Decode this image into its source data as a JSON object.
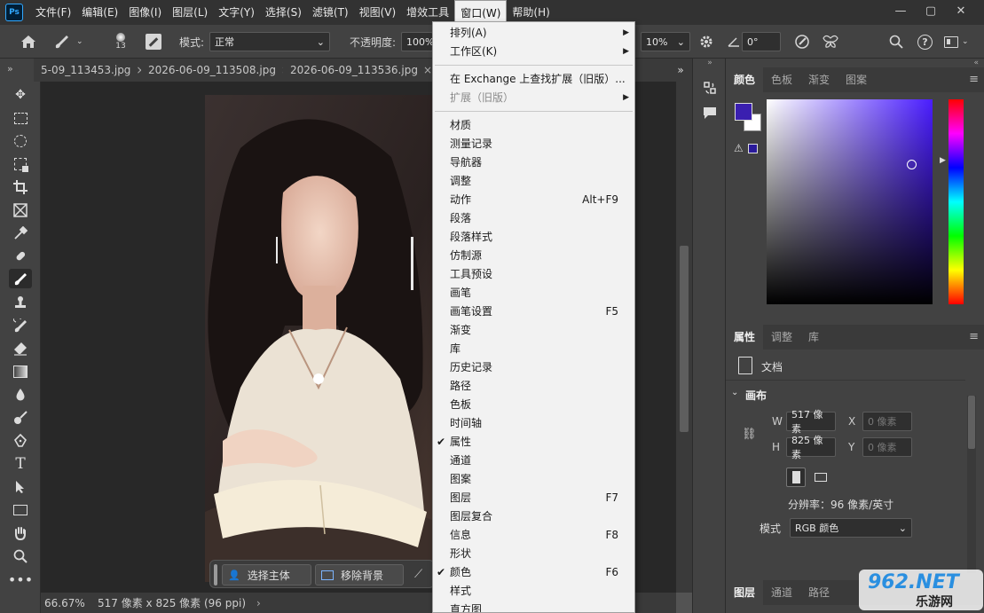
{
  "app": {
    "logo": "Ps"
  },
  "menubar": {
    "items": [
      "文件(F)",
      "编辑(E)",
      "图像(I)",
      "图层(L)",
      "文字(Y)",
      "选择(S)",
      "滤镜(T)",
      "视图(V)",
      "增效工具",
      "窗口(W)",
      "帮助(H)"
    ],
    "window_buttons": [
      "—",
      "▢",
      "✕"
    ]
  },
  "options": {
    "brush_size": "13",
    "mode_label": "模式:",
    "mode_value": "正常",
    "opacity_label": "不透明度:",
    "opacity_value": "100%",
    "flow_value": "10%",
    "angle_value": "0°"
  },
  "tabs": [
    {
      "label": "5-09_113453.jpg",
      "close": "×"
    },
    {
      "label": "2026-06-09_113508.jpg",
      "close": "×"
    },
    {
      "label": "2026-06-09_113536.jpg",
      "close": "×"
    }
  ],
  "tabs_overflow": "»",
  "canvas_context": {
    "select_subject": "选择主体",
    "remove_bg": "移除背景"
  },
  "status": {
    "zoom": "66.67%",
    "doc_info": "517 像素 x 825 像素 (96 ppi)",
    "nav_arrow": "›"
  },
  "window_menu": {
    "items": [
      {
        "label": "排列(A)",
        "submenu": true
      },
      {
        "label": "工作区(K)",
        "submenu": true
      },
      {
        "sep": true
      },
      {
        "label": "在 Exchange 上查找扩展（旧版）..."
      },
      {
        "label": "扩展（旧版）",
        "submenu": true,
        "disabled": true
      },
      {
        "sep": true
      },
      {
        "label": "材质"
      },
      {
        "label": "测量记录"
      },
      {
        "label": "导航器"
      },
      {
        "label": "调整"
      },
      {
        "label": "动作",
        "shortcut": "Alt+F9"
      },
      {
        "label": "段落"
      },
      {
        "label": "段落样式"
      },
      {
        "label": "仿制源"
      },
      {
        "label": "工具预设"
      },
      {
        "label": "画笔"
      },
      {
        "label": "画笔设置",
        "shortcut": "F5"
      },
      {
        "label": "渐变"
      },
      {
        "label": "库"
      },
      {
        "label": "历史记录"
      },
      {
        "label": "路径"
      },
      {
        "label": "色板"
      },
      {
        "label": "时间轴"
      },
      {
        "label": "属性",
        "checked": true
      },
      {
        "label": "通道"
      },
      {
        "label": "图案"
      },
      {
        "label": "图层",
        "shortcut": "F7"
      },
      {
        "label": "图层复合"
      },
      {
        "label": "信息",
        "shortcut": "F8"
      },
      {
        "label": "形状"
      },
      {
        "label": "颜色",
        "shortcut": "F6",
        "checked": true
      },
      {
        "label": "样式"
      },
      {
        "label": "直方图"
      }
    ]
  },
  "color_panel": {
    "tabs": [
      "颜色",
      "色板",
      "渐变",
      "图案"
    ],
    "foreground": "#3a1fb0",
    "background": "#ffffff"
  },
  "properties_panel": {
    "tabs": [
      "属性",
      "调整",
      "库"
    ],
    "doc_label": "文档",
    "section": "画布",
    "w_label": "W",
    "w_value": "517 像素",
    "h_label": "H",
    "h_value": "825 像素",
    "x_label": "X",
    "x_placeholder": "0 像素",
    "y_label": "Y",
    "y_placeholder": "0 像素",
    "resolution": "分辨率：96 像素/英寸",
    "mode_label": "模式",
    "mode_value": "RGB 颜色"
  },
  "layers_panel": {
    "tabs": [
      "图层",
      "通道",
      "路径"
    ]
  },
  "watermark": {
    "text": "962.NET",
    "sub": "乐游网"
  }
}
